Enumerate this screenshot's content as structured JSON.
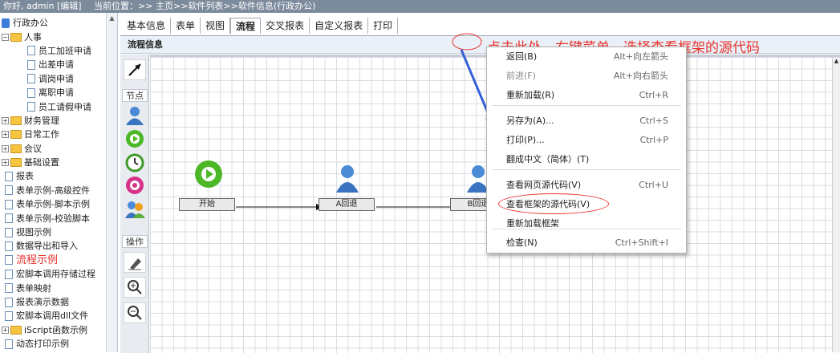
{
  "topbar": {
    "greeting": "你好, admin [编辑]",
    "location": "当前位置：>> 主页>>软件列表>>软件信息(行政办公)"
  },
  "sidebar": {
    "root": "行政办公",
    "items": [
      {
        "label": "人事",
        "type": "folder",
        "toggle": "⊟",
        "level": 0
      },
      {
        "label": "员工加班申请",
        "type": "doc",
        "level": 2
      },
      {
        "label": "出差申请",
        "type": "doc",
        "level": 2
      },
      {
        "label": "调岗申请",
        "type": "doc",
        "level": 2
      },
      {
        "label": "离职申请",
        "type": "doc",
        "level": 2
      },
      {
        "label": "员工请假申请",
        "type": "doc",
        "level": 2
      },
      {
        "label": "财务管理",
        "type": "folder",
        "toggle": "⊞",
        "level": 0
      },
      {
        "label": "日常工作",
        "type": "folder",
        "toggle": "⊞",
        "level": 0
      },
      {
        "label": "会议",
        "type": "folder",
        "toggle": "⊞",
        "level": 0
      },
      {
        "label": "基础设置",
        "type": "folder",
        "toggle": "⊞",
        "level": 0
      },
      {
        "label": "报表",
        "type": "doc",
        "level": 1
      },
      {
        "label": "表单示例-高级控件",
        "type": "doc",
        "level": 1
      },
      {
        "label": "表单示例-脚本示例",
        "type": "doc",
        "level": 1
      },
      {
        "label": "表单示例-校验脚本",
        "type": "doc",
        "level": 1
      },
      {
        "label": "视图示例",
        "type": "doc",
        "level": 1
      },
      {
        "label": "数据导出和导入",
        "type": "doc",
        "level": 1
      },
      {
        "label": "流程示例",
        "type": "doc",
        "level": 1,
        "highlight": true
      },
      {
        "label": "宏脚本调用存储过程",
        "type": "doc",
        "level": 1
      },
      {
        "label": "表单映射",
        "type": "doc",
        "level": 1
      },
      {
        "label": "报表演示数据",
        "type": "doc",
        "level": 1
      },
      {
        "label": "宏脚本调用dll文件",
        "type": "doc",
        "level": 1
      },
      {
        "label": "iScript函数示例",
        "type": "folder",
        "toggle": "⊞",
        "level": 0
      },
      {
        "label": "动态打印示例",
        "type": "doc",
        "level": 1
      }
    ]
  },
  "tabs": [
    {
      "label": "基本信息",
      "active": false
    },
    {
      "label": "表单",
      "active": false
    },
    {
      "label": "视图",
      "active": false
    },
    {
      "label": "流程",
      "active": true
    },
    {
      "label": "交叉报表",
      "active": false
    },
    {
      "label": "自定义报表",
      "active": false
    },
    {
      "label": "打印",
      "active": false
    }
  ],
  "panel": {
    "title": "流程信息"
  },
  "toolbox": {
    "section_nodes": "节点",
    "section_ops": "操作"
  },
  "flow": {
    "nodes": [
      {
        "label": "开始",
        "kind": "start-node"
      },
      {
        "label": "A回退",
        "kind": "person-node"
      },
      {
        "label": "B回退",
        "kind": "person-node"
      }
    ]
  },
  "context_menu": {
    "items": [
      {
        "label": "返回(B)",
        "shortcut": "Alt+向左箭头",
        "disabled": false
      },
      {
        "label": "前进(F)",
        "shortcut": "Alt+向右箭头",
        "disabled": true
      },
      {
        "label": "重新加载(R)",
        "shortcut": "Ctrl+R",
        "disabled": false
      },
      {
        "label": "另存为(A)...",
        "shortcut": "Ctrl+S",
        "disabled": false
      },
      {
        "label": "打印(P)...",
        "shortcut": "Ctrl+P",
        "disabled": false
      },
      {
        "label": "翻成中文（简体）(T)",
        "shortcut": "",
        "disabled": false
      },
      {
        "label": "查看网页源代码(V)",
        "shortcut": "Ctrl+U",
        "disabled": false
      },
      {
        "label": "查看框架的源代码(V)",
        "shortcut": "",
        "disabled": false,
        "circled": true
      },
      {
        "label": "重新加载框架",
        "shortcut": "",
        "disabled": false
      },
      {
        "label": "检查(N)",
        "shortcut": "Ctrl+Shift+I",
        "disabled": false
      }
    ]
  },
  "annotation": {
    "text": "点击此处，右键菜单，选择查看框架的源代码",
    "color": "#e8322c"
  }
}
